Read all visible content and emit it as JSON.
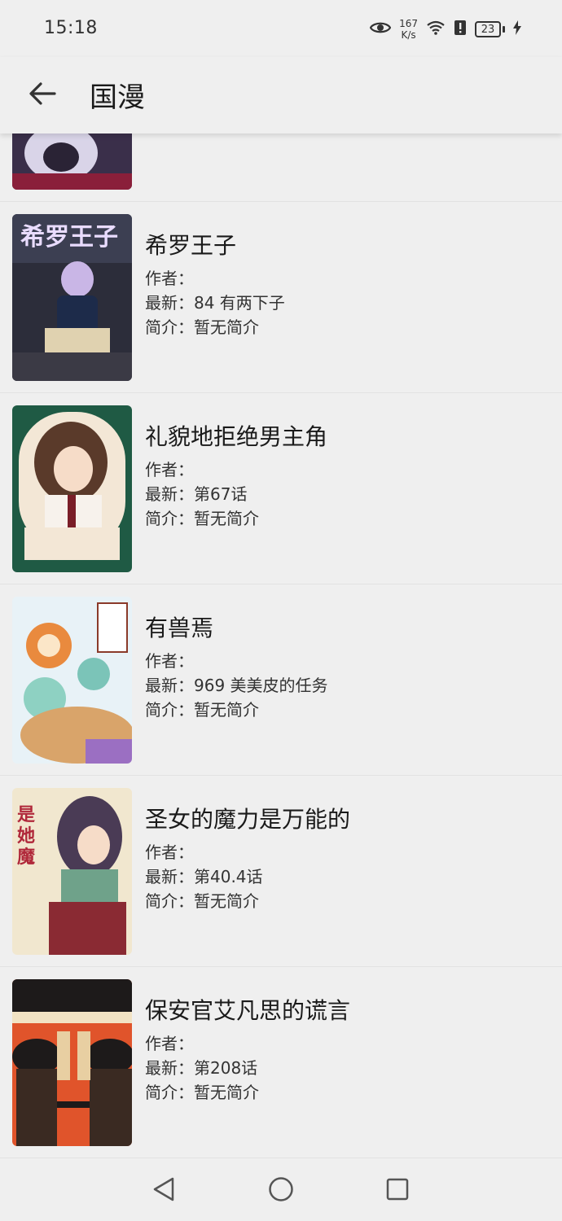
{
  "status_bar": {
    "time": "15:18",
    "net_speed_value": "167",
    "net_speed_unit": "K/s",
    "battery": "23",
    "icons": [
      "eye-icon",
      "wifi-icon",
      "alert-icon",
      "battery-icon",
      "charging-icon"
    ]
  },
  "app_bar": {
    "title": "国漫",
    "back_icon": "arrow-left-icon"
  },
  "items": [
    {
      "title": "希罗王子",
      "author_label": "作者：",
      "latest_label": "最新：",
      "latest": "84 有两下子",
      "intro_label": "简介：",
      "intro": "暂无简介",
      "cover_colors": [
        "#2c2d3a",
        "#c9b6e6",
        "#5a6a8a"
      ]
    },
    {
      "title": "礼貌地拒绝男主角",
      "author_label": "作者：",
      "latest_label": "最新：",
      "latest": "第67话",
      "intro_label": "简介：",
      "intro": "暂无简介",
      "cover_colors": [
        "#1f5a44",
        "#f3e7d6",
        "#5a3a2a"
      ]
    },
    {
      "title": "有兽焉",
      "author_label": "作者：",
      "latest_label": "最新：",
      "latest": "969 美美皮的任务",
      "intro_label": "简介：",
      "intro": "暂无简介",
      "cover_colors": [
        "#e8f2f7",
        "#e98a3e",
        "#7bc4b8"
      ]
    },
    {
      "title": "圣女的魔力是万能的",
      "author_label": "作者：",
      "latest_label": "最新：",
      "latest": "第40.4话",
      "intro_label": "简介：",
      "intro": "暂无简介",
      "cover_colors": [
        "#f1e7cf",
        "#8a2a33",
        "#4a3b55"
      ]
    },
    {
      "title": "保安官艾凡思的谎言",
      "author_label": "作者：",
      "latest_label": "最新：",
      "latest": "第208话",
      "intro_label": "简介：",
      "intro": "暂无简介",
      "cover_colors": [
        "#e0542b",
        "#1d1a1a",
        "#e8cfa2"
      ]
    }
  ],
  "nav_bar": {
    "buttons": [
      "back-triangle-icon",
      "home-circle-icon",
      "recents-square-icon"
    ]
  }
}
